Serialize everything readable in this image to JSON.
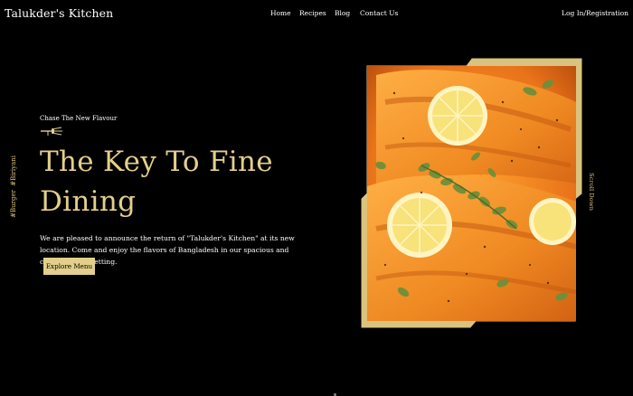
{
  "brand": {
    "name": "Talukder's Kitchen"
  },
  "nav": {
    "items": [
      "Home",
      "Recipes",
      "Blog",
      "Contact Us"
    ],
    "login_label": "Log In/Registration"
  },
  "side_tags": [
    "#Biriyani",
    "#Burger"
  ],
  "hero": {
    "tagline": "Chase The New Flavour",
    "headline_line1": "The Key To Fine",
    "headline_line2": "Dining",
    "intro": "We are pleased to announce the return of \"Talukder's Kitchen\" at its new location. Come and enjoy the flavors of Bangladesh in our spacious and contemporary setting.",
    "cta_label": "Explore Menu",
    "icon": "fork-knife-icon"
  },
  "scroll_label": "Scroll Down",
  "colors": {
    "background": "#000000",
    "accent": "#e3cf8b",
    "text": "#ffffff"
  }
}
